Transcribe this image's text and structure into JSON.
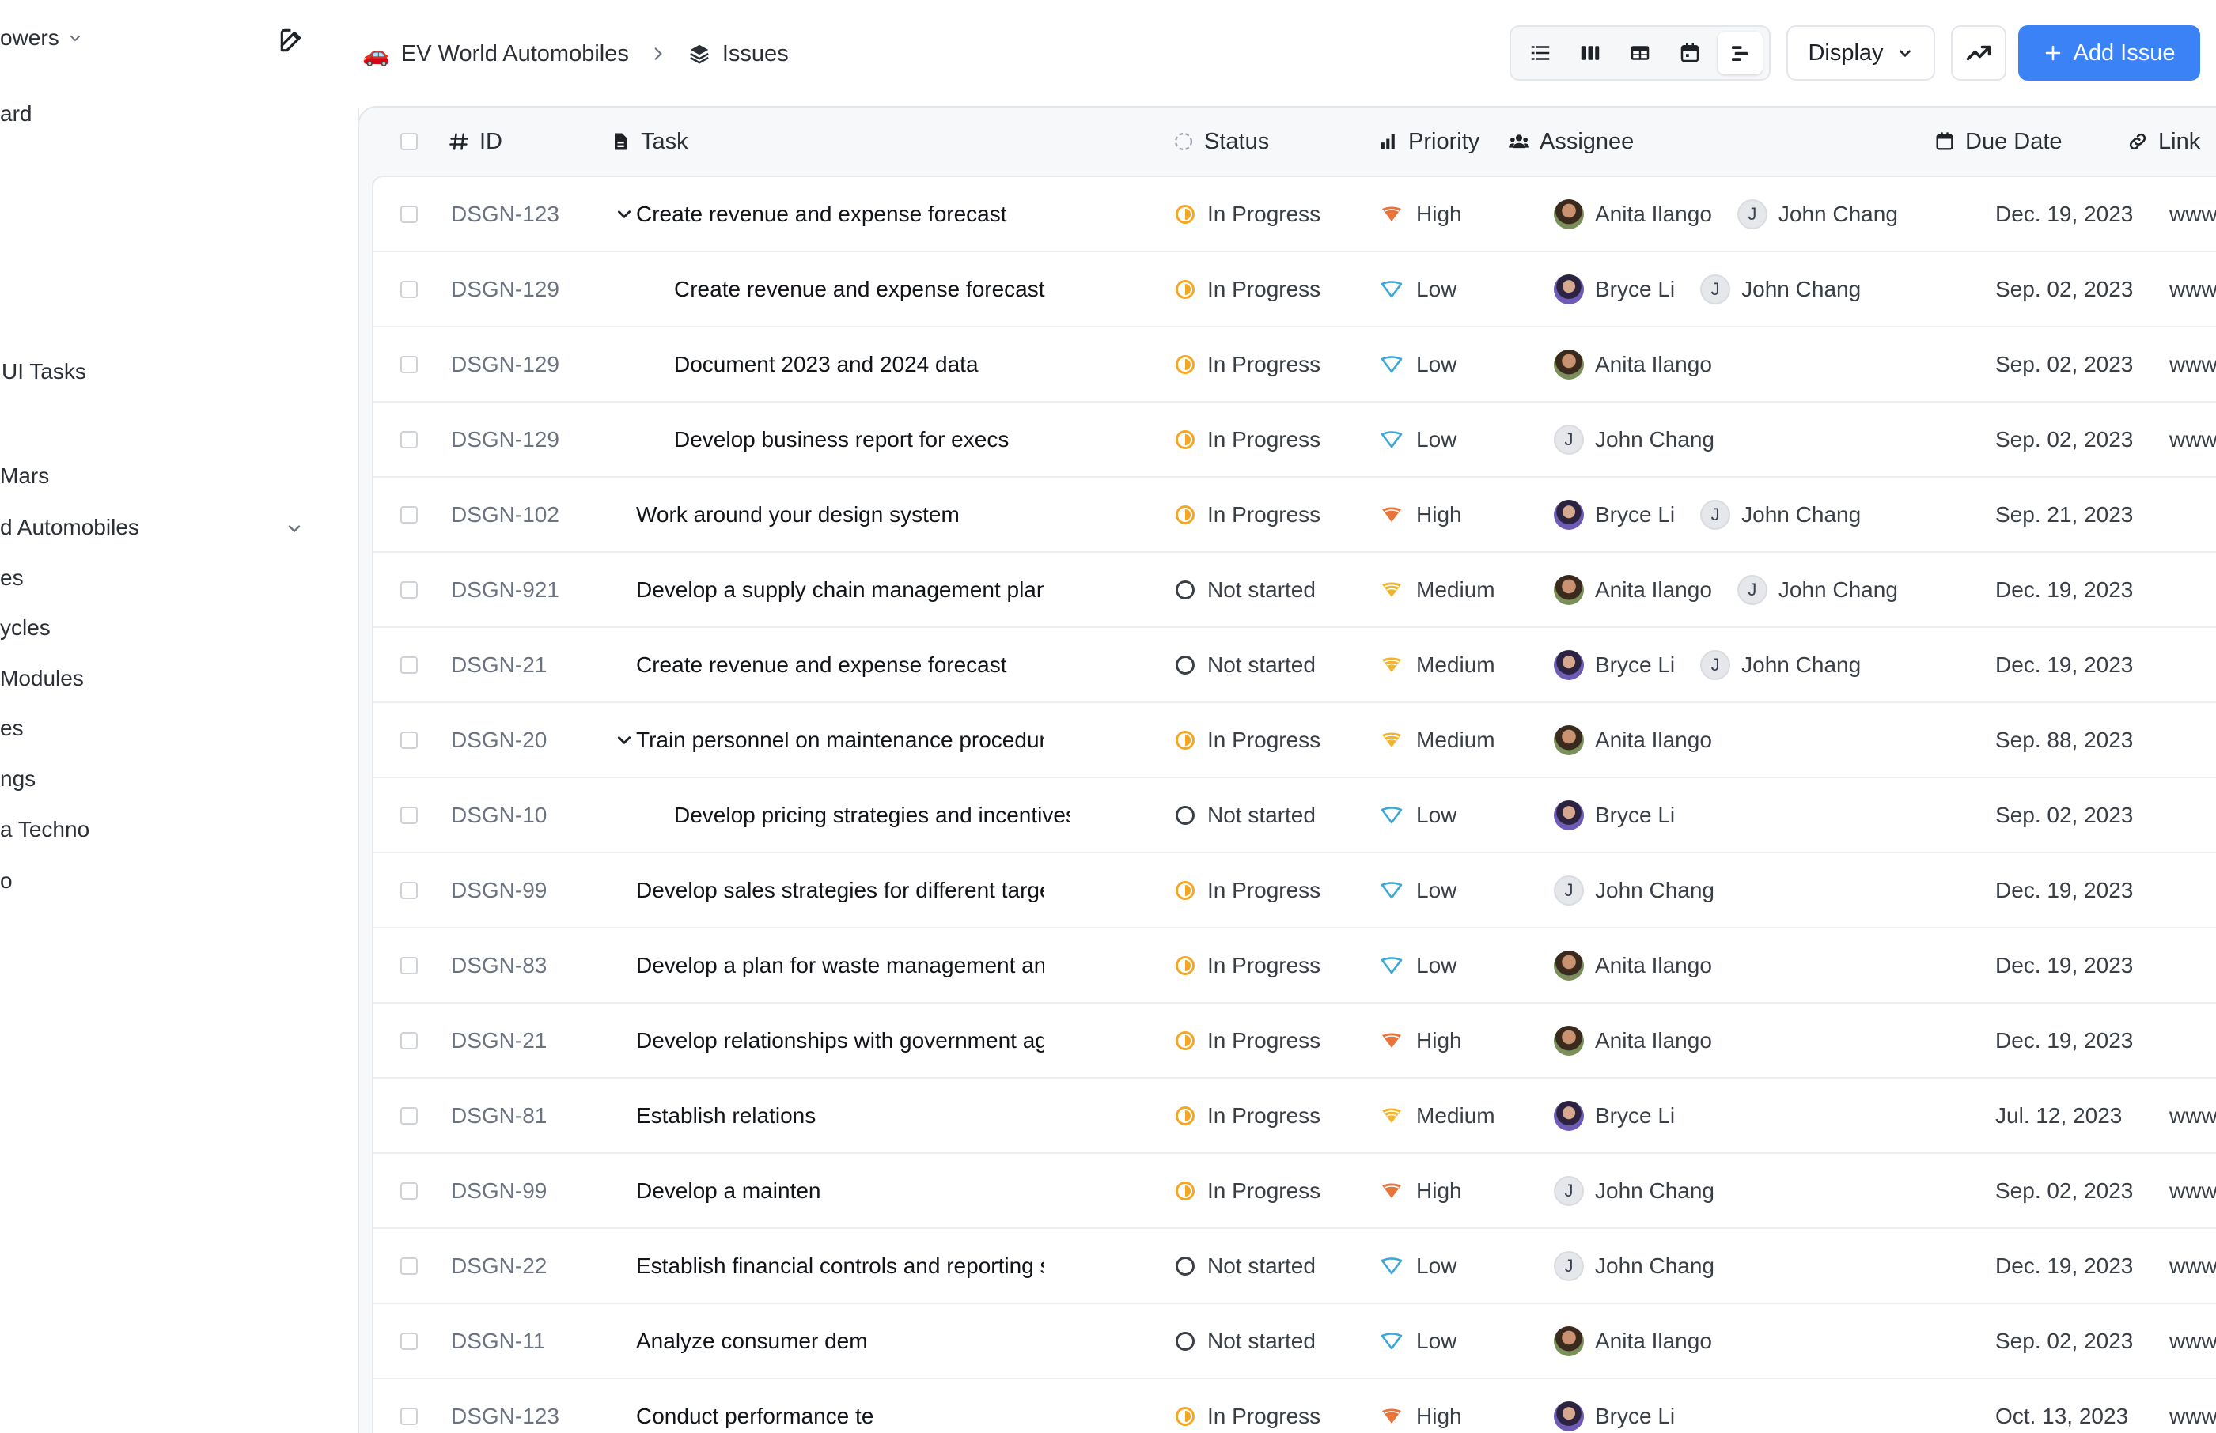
{
  "sidebar": {
    "workspace": "owers",
    "items": [
      "ard",
      "UI Tasks",
      "Mars",
      "d Automobiles",
      "es",
      "ycles",
      "Modules",
      "es",
      "ngs",
      "a Techno",
      "o"
    ]
  },
  "breadcrumb": {
    "project": "EV World Automobiles",
    "page": "Issues",
    "project_icon": "🚗"
  },
  "toolbar": {
    "display_label": "Display",
    "add_label": "Add Issue"
  },
  "columns": {
    "id": "ID",
    "task": "Task",
    "status": "Status",
    "priority": "Priority",
    "assignee": "Assignee",
    "due": "Due Date",
    "link": "Link"
  },
  "rows": [
    {
      "id": "DSGN-123",
      "task": "Create revenue and expense forecast",
      "indent": 0,
      "caret": true,
      "status": "In Progress",
      "priority": "High",
      "assignees": [
        "Anita Ilango",
        "John Chang"
      ],
      "due": "Dec. 19, 2023",
      "link": "www"
    },
    {
      "id": "DSGN-129",
      "task": "Create revenue and expense forecast",
      "indent": 1,
      "caret": false,
      "status": "In Progress",
      "priority": "Low",
      "assignees": [
        "Bryce Li",
        "John Chang"
      ],
      "due": "Sep. 02, 2023",
      "link": "www"
    },
    {
      "id": "DSGN-129",
      "task": "Document 2023 and 2024 data",
      "indent": 1,
      "caret": false,
      "status": "In Progress",
      "priority": "Low",
      "assignees": [
        "Anita Ilango"
      ],
      "due": "Sep. 02, 2023",
      "link": "www"
    },
    {
      "id": "DSGN-129",
      "task": "Develop business report for execs",
      "indent": 1,
      "caret": false,
      "status": "In Progress",
      "priority": "Low",
      "assignees": [
        "John Chang"
      ],
      "due": "Sep. 02, 2023",
      "link": "www"
    },
    {
      "id": "DSGN-102",
      "task": "Work around your design system",
      "indent": 0,
      "caret": false,
      "status": "In Progress",
      "priority": "High",
      "assignees": [
        "Bryce Li",
        "John Chang"
      ],
      "due": "Sep. 21, 2023",
      "link": ""
    },
    {
      "id": "DSGN-921",
      "task": "Develop a supply chain management plan",
      "indent": 0,
      "caret": false,
      "status": "Not started",
      "priority": "Medium",
      "assignees": [
        "Anita Ilango",
        "John Chang"
      ],
      "due": "Dec. 19, 2023",
      "link": ""
    },
    {
      "id": "DSGN-21",
      "task": "Create revenue and expense forecast",
      "indent": 0,
      "caret": false,
      "status": "Not started",
      "priority": "Medium",
      "assignees": [
        "Bryce Li",
        "John Chang"
      ],
      "due": "Dec. 19, 2023",
      "link": ""
    },
    {
      "id": "DSGN-20",
      "task": "Train personnel on maintenance procedures",
      "indent": 0,
      "caret": true,
      "status": "In Progress",
      "priority": "Medium",
      "assignees": [
        "Anita Ilango"
      ],
      "due": "Sep. 88, 2023",
      "link": ""
    },
    {
      "id": "DSGN-10",
      "task": "Develop pricing strategies and incentives",
      "indent": 1,
      "caret": false,
      "status": "Not started",
      "priority": "Low",
      "assignees": [
        "Bryce Li"
      ],
      "due": "Sep. 02, 2023",
      "link": ""
    },
    {
      "id": "DSGN-99",
      "task": "Develop sales strategies for different target den",
      "indent": 0,
      "caret": false,
      "status": "In Progress",
      "priority": "Low",
      "assignees": [
        "John Chang"
      ],
      "due": "Dec. 19, 2023",
      "link": ""
    },
    {
      "id": "DSGN-83",
      "task": "Develop a plan for waste management and recy",
      "indent": 0,
      "caret": false,
      "status": "In Progress",
      "priority": "Low",
      "assignees": [
        "Anita Ilango"
      ],
      "due": "Dec. 19, 2023",
      "link": ""
    },
    {
      "id": "DSGN-21",
      "task": "Develop relationships with government agents a",
      "indent": 0,
      "caret": false,
      "status": "In Progress",
      "priority": "High",
      "assignees": [
        "Anita Ilango"
      ],
      "due": "Dec. 19, 2023",
      "link": ""
    },
    {
      "id": "DSGN-81",
      "task": "Establish relations",
      "indent": 0,
      "caret": false,
      "status": "In Progress",
      "priority": "Medium",
      "assignees": [
        "Bryce Li"
      ],
      "due": "Jul. 12, 2023",
      "link": "www"
    },
    {
      "id": "DSGN-99",
      "task": "Develop a mainten",
      "indent": 0,
      "caret": false,
      "status": "In Progress",
      "priority": "High",
      "assignees": [
        "John Chang"
      ],
      "due": "Sep. 02, 2023",
      "link": "www"
    },
    {
      "id": "DSGN-22",
      "task": "Establish financial controls and reporting systen",
      "indent": 0,
      "caret": false,
      "status": "Not started",
      "priority": "Low",
      "assignees": [
        "John Chang"
      ],
      "due": "Dec. 19, 2023",
      "link": "www"
    },
    {
      "id": "DSGN-11",
      "task": "Analyze consumer dem",
      "indent": 0,
      "caret": false,
      "status": "Not started",
      "priority": "Low",
      "assignees": [
        "Anita Ilango"
      ],
      "due": "Sep. 02, 2023",
      "link": "www"
    },
    {
      "id": "DSGN-123",
      "task": "Conduct performance te",
      "indent": 0,
      "caret": false,
      "status": "In Progress",
      "priority": "High",
      "assignees": [
        "Bryce Li"
      ],
      "due": "Oct. 13, 2023",
      "link": "www"
    }
  ],
  "colors": {
    "accent": "#3b82f6",
    "in_progress": "#f5a623",
    "high": "#e8743b",
    "medium": "#f2b42c",
    "low": "#3aa7d9"
  },
  "avatar_initial_john": "J"
}
